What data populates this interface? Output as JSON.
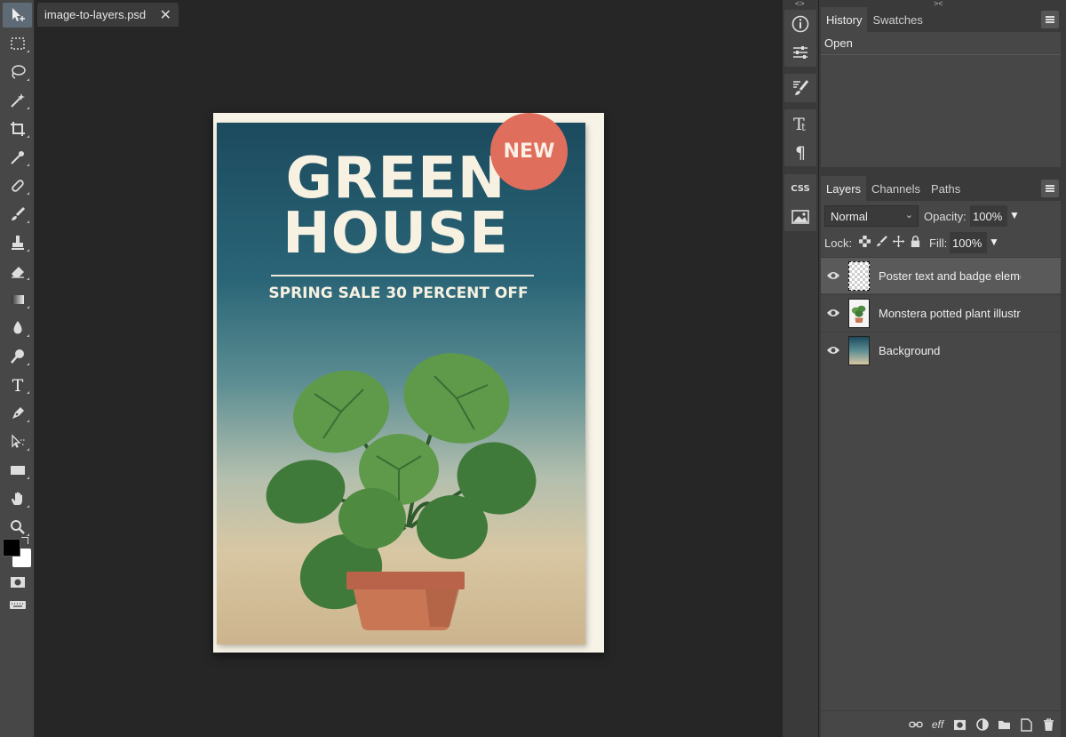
{
  "document": {
    "tab_name": "image-to-layers.psd",
    "close_glyph": "✕"
  },
  "toolbar": {
    "tools": [
      "move-tool-icon",
      "marquee-tool-icon",
      "lasso-tool-icon",
      "magic-wand-icon",
      "crop-tool-icon",
      "eyedropper-icon",
      "healing-brush-icon",
      "brush-tool-icon",
      "stamp-tool-icon",
      "eraser-tool-icon",
      "gradient-tool-icon",
      "blur-tool-icon",
      "dodge-tool-icon",
      "type-tool-icon",
      "pen-tool-icon",
      "path-select-icon",
      "shape-tool-icon",
      "hand-tool-icon",
      "zoom-tool-icon"
    ],
    "active_tool": "move-tool-icon",
    "foreground_color": "#000000",
    "background_color": "#ffffff"
  },
  "poster": {
    "title_line1": "GREEN",
    "title_line2": "HOUSE",
    "subtitle": "SPRING SALE 30 PERCENT OFF",
    "badge": "NEW",
    "badge_color": "#e06e5c"
  },
  "icon_column": {
    "groups": [
      [
        "info-icon",
        "adjust-sliders-icon"
      ],
      [
        "brush-settings-icon"
      ],
      [
        "character-icon",
        "paragraph-icon"
      ],
      [
        "css-icon",
        "image-icon"
      ]
    ],
    "css_label": "CSS"
  },
  "history_panel": {
    "tabs": [
      "History",
      "Swatches"
    ],
    "items": [
      "Open"
    ]
  },
  "layers_panel": {
    "tabs": [
      "Layers",
      "Channels",
      "Paths"
    ],
    "blend_mode": "Normal",
    "opacity_label": "Opacity:",
    "opacity_value": "100%",
    "lock_label": "Lock:",
    "fill_label": "Fill:",
    "fill_value": "100%",
    "layers": [
      {
        "name": "Poster text and badge elements",
        "selected": true
      },
      {
        "name": "Monstera potted plant illustration",
        "selected": false
      },
      {
        "name": "Background",
        "selected": false
      }
    ],
    "footer_icons": [
      "link-icon",
      "effects-icon",
      "mask-icon",
      "adjustment-icon",
      "folder-icon",
      "new-layer-icon",
      "trash-icon"
    ],
    "effects_label": "eff"
  }
}
